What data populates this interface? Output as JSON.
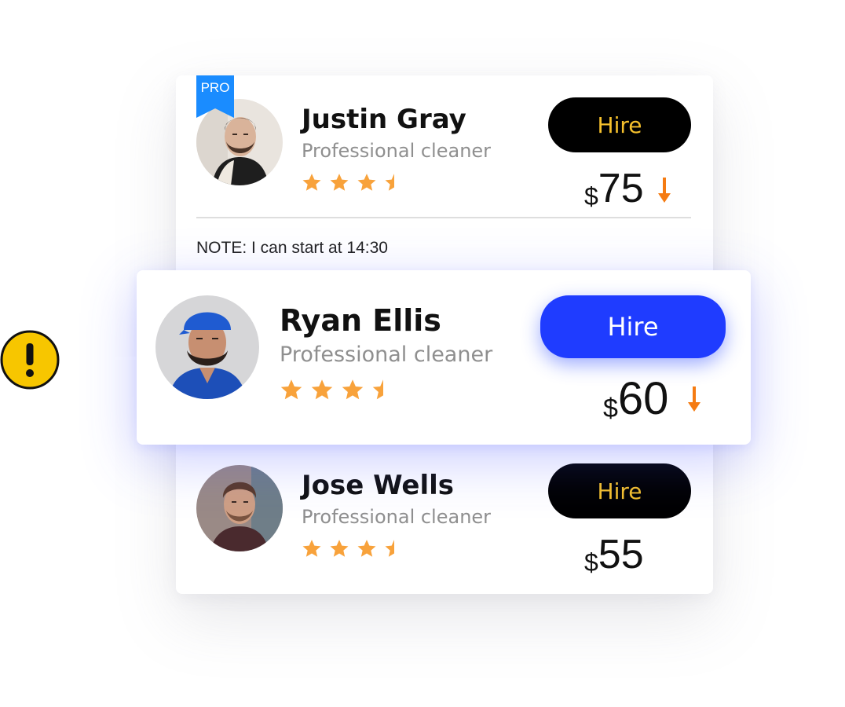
{
  "workers": [
    {
      "name": "Justin Gray",
      "role": "Professional cleaner",
      "rating": 3.5,
      "hire_label": "Hire",
      "currency": "$",
      "price": "75",
      "badge": "PRO",
      "note": "NOTE: I can start at 14:30",
      "avatar_icon": "man-with-beard-portrait",
      "price_trend_icon": "arrow-down-icon"
    },
    {
      "name": "Ryan Ellis",
      "role": "Professional cleaner",
      "rating": 3.5,
      "hire_label": "Hire",
      "currency": "$",
      "price": "60",
      "avatar_icon": "man-in-blue-cap-portrait",
      "price_trend_icon": "arrow-down-icon"
    },
    {
      "name": "Jose Wells",
      "role": "Professional cleaner",
      "rating": 3.5,
      "hire_label": "Hire",
      "currency": "$",
      "price": "55",
      "avatar_icon": "young-man-portrait"
    }
  ],
  "alert": {
    "icon": "exclamation-icon",
    "color": "#f7c600"
  },
  "colors": {
    "dark_button": "#000000",
    "dark_button_text": "#f5c02c",
    "primary_button": "#1f3cff",
    "star": "#f8a23b",
    "arrow": "#f57b12",
    "pro_badge": "#1a8cff"
  }
}
